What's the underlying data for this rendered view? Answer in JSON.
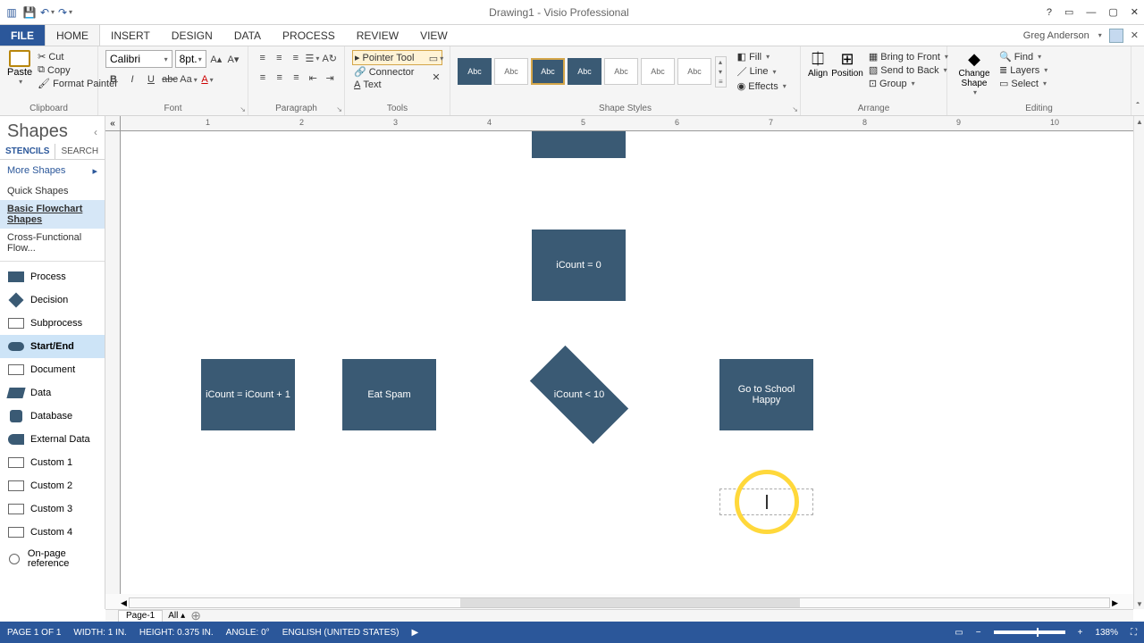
{
  "titlebar": {
    "title": "Drawing1 - Visio Professional"
  },
  "user": {
    "name": "Greg Anderson"
  },
  "tabs": {
    "file": "FILE",
    "home": "HOME",
    "insert": "INSERT",
    "design": "DESIGN",
    "data": "DATA",
    "process": "PROCESS",
    "review": "REVIEW",
    "view": "VIEW"
  },
  "ribbon": {
    "clipboard": {
      "title": "Clipboard",
      "paste": "Paste",
      "cut": "Cut",
      "copy": "Copy",
      "painter": "Format Painter"
    },
    "font": {
      "title": "Font",
      "name": "Calibri",
      "size": "8pt."
    },
    "paragraph": {
      "title": "Paragraph"
    },
    "tools": {
      "title": "Tools",
      "pointer": "Pointer Tool",
      "connector": "Connector",
      "text": "Text"
    },
    "shapestyles": {
      "title": "Shape Styles",
      "fill": "Fill",
      "line": "Line",
      "effects": "Effects",
      "abc": "Abc"
    },
    "arrange": {
      "title": "Arrange",
      "align": "Align",
      "position": "Position",
      "front": "Bring to Front",
      "back": "Send to Back",
      "group": "Group"
    },
    "editing": {
      "title": "Editing",
      "change": "Change Shape",
      "find": "Find",
      "layers": "Layers",
      "select": "Select"
    }
  },
  "shapesPanel": {
    "title": "Shapes",
    "tabStencils": "STENCILS",
    "tabSearch": "SEARCH",
    "more": "More Shapes",
    "quick": "Quick Shapes",
    "catBasic": "Basic Flowchart Shapes",
    "catCross": "Cross-Functional Flow...",
    "items": [
      {
        "label": "Process"
      },
      {
        "label": "Decision"
      },
      {
        "label": "Subprocess"
      },
      {
        "label": "Start/End"
      },
      {
        "label": "Document"
      },
      {
        "label": "Data"
      },
      {
        "label": "Database"
      },
      {
        "label": "External Data"
      },
      {
        "label": "Custom 1"
      },
      {
        "label": "Custom 2"
      },
      {
        "label": "Custom 3"
      },
      {
        "label": "Custom 4"
      },
      {
        "label": "On-page reference"
      }
    ]
  },
  "canvas": {
    "shapes": {
      "topBox": "",
      "countInit": "iCount = 0",
      "countInc": "iCount = iCount + 1",
      "eatSpam": "Eat Spam",
      "decision": "iCount < 10",
      "school": "Go to School Happy"
    },
    "ruler": [
      "1",
      "2",
      "3",
      "4",
      "5",
      "6",
      "7",
      "8",
      "9",
      "10"
    ]
  },
  "pages": {
    "page1": "Page-1",
    "all": "All"
  },
  "status": {
    "page": "PAGE 1 OF 1",
    "width": "WIDTH: 1 IN.",
    "height": "HEIGHT: 0.375 IN.",
    "angle": "ANGLE: 0°",
    "lang": "ENGLISH (UNITED STATES)",
    "zoom": "138%"
  }
}
